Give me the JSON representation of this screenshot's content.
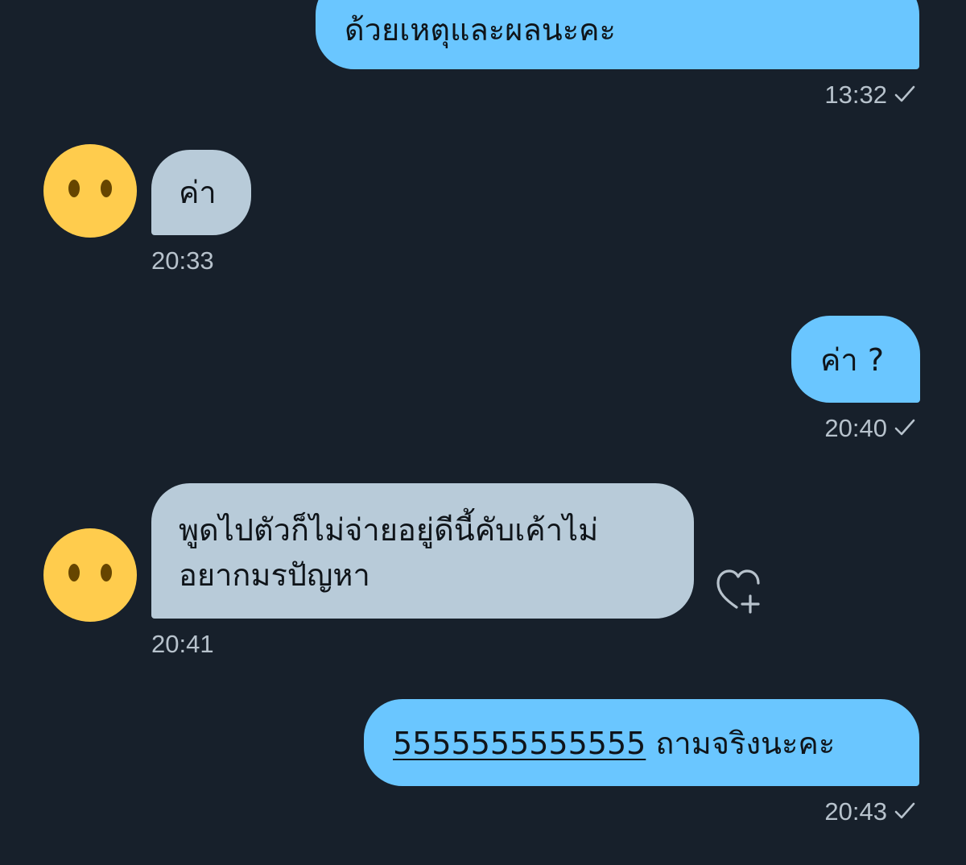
{
  "conversation": {
    "messages": [
      {
        "direction": "outgoing",
        "text": "ด้วยเหตุและผลนะคะ",
        "time": "13:32"
      },
      {
        "direction": "incoming",
        "text": "ค่า",
        "time": "20:33"
      },
      {
        "direction": "outgoing",
        "text": "ค่า ?",
        "time": "20:40"
      },
      {
        "direction": "incoming",
        "line1": "พูดไปตัวก็ไม่จ่ายอยู่ดีนี้คับเค้าไม่",
        "line2": "อยากมรปัญหา",
        "time": "20:41"
      },
      {
        "direction": "outgoing",
        "link": "5555555555555",
        "text": " ถามจริงนะคะ",
        "time": "20:43"
      }
    ]
  },
  "icons": {
    "avatar": "neutral-face-emoji-icon",
    "read_receipt": "checkmark-icon",
    "react": "heart-plus-icon"
  },
  "colors": {
    "background": "#17202b",
    "outgoing_bubble": "#6ac6ff",
    "incoming_bubble": "#b8cbd9",
    "timestamp": "#b7c2cc",
    "avatar_face": "#ffcc4d"
  }
}
